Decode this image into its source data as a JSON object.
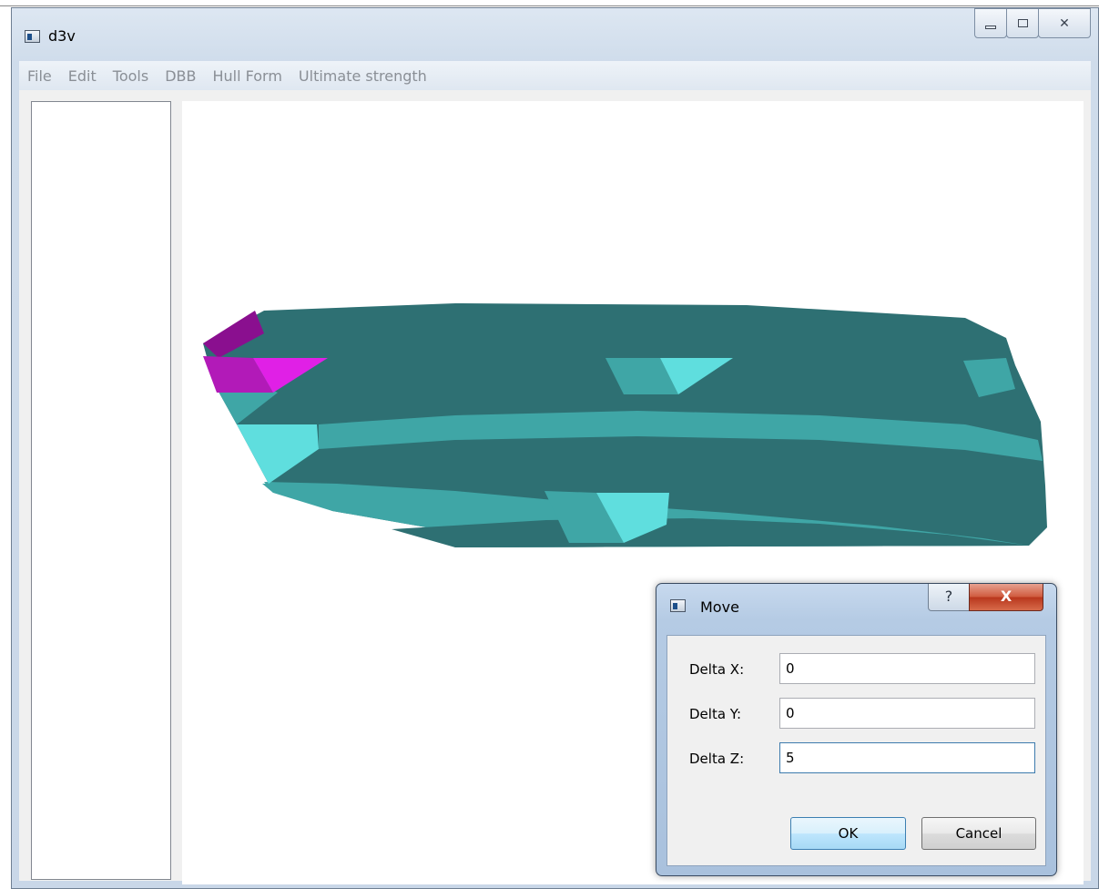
{
  "window": {
    "title": "d3v",
    "minimize_glyph": "",
    "maximize_glyph": "",
    "close_glyph": "✕"
  },
  "menu": [
    "File",
    "Edit",
    "Tools",
    "DBB",
    "Hull Form",
    "Ultimate strength"
  ],
  "viewport": {
    "colors": {
      "hull_dark": "#2e7073",
      "hull_mid": "#3fa6a6",
      "hull_light": "#5fdede",
      "highlight": "#c020c8"
    }
  },
  "dialog": {
    "title": "Move",
    "help_glyph": "?",
    "close_glyph": "X",
    "fields": [
      {
        "label": "Delta X:",
        "value": "0"
      },
      {
        "label": "Delta Y:",
        "value": "0"
      },
      {
        "label": "Delta Z:",
        "value": "5"
      }
    ],
    "ok_label": "OK",
    "cancel_label": "Cancel"
  }
}
